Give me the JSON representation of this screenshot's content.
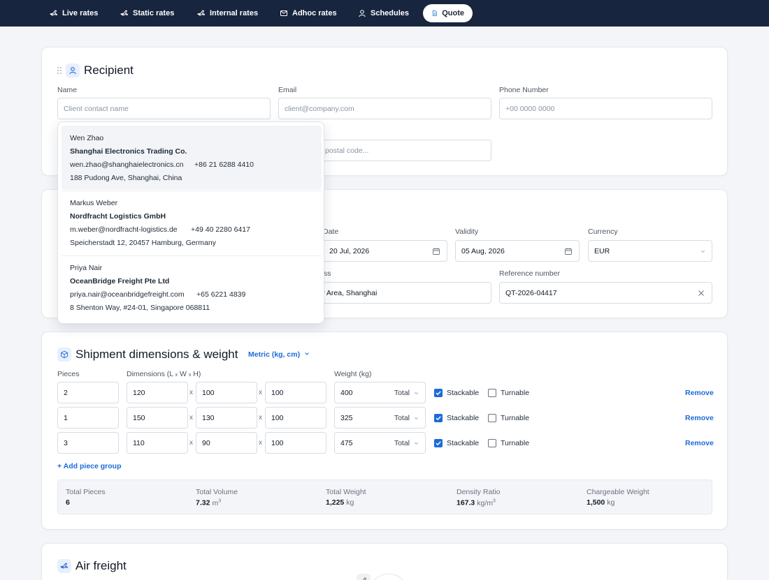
{
  "nav": {
    "items": [
      {
        "label": "Live rates",
        "icon": "plane-icon",
        "active": false
      },
      {
        "label": "Static rates",
        "icon": "plane-icon",
        "active": false
      },
      {
        "label": "Internal rates",
        "icon": "plane-icon",
        "active": false
      },
      {
        "label": "Adhoc rates",
        "icon": "mail-icon",
        "active": false
      },
      {
        "label": "Schedules",
        "icon": "user-icon",
        "active": false
      },
      {
        "label": "Quote",
        "icon": "document-icon",
        "active": true
      }
    ]
  },
  "recipient": {
    "title": "Recipient",
    "name": {
      "label": "Name",
      "placeholder": "Client contact name"
    },
    "email": {
      "label": "Email",
      "placeholder": "client@company.com"
    },
    "phone": {
      "label": "Phone Number",
      "placeholder": "+00 0000 0000"
    },
    "address_placeholder_fragment": "postal code...",
    "suggestions": [
      {
        "name": "Wen Zhao",
        "company": "Shanghai Electronics Trading Co.",
        "email": "wen.zhao@shanghaielectronics.cn",
        "phone": "+86 21 6288 4410",
        "address": "188 Pudong Ave, Shanghai, China",
        "highlighted": true
      },
      {
        "name": "Markus Weber",
        "company": "Nordfracht Logistics GmbH",
        "email": "m.weber@nordfracht-logistics.de",
        "phone": "+49 40 2280 6417",
        "address": "Speicherstadt 12, 20457 Hamburg, Germany",
        "highlighted": false
      },
      {
        "name": "Priya Nair",
        "company": "OceanBridge Freight Pte Ltd",
        "email": "priya.nair@oceanbridgefreight.com",
        "phone": "+65 6221 4839",
        "address": "8 Shenton Way, #24-01, Singapore 068811",
        "highlighted": false
      }
    ]
  },
  "quote": {
    "date": {
      "label": "Date",
      "value": "20 Jul, 2026"
    },
    "validity": {
      "label": "Validity",
      "value": "05 Aug, 2026"
    },
    "currency": {
      "label": "Currency",
      "value": "EUR"
    },
    "address": {
      "label_fragment": "ess",
      "value_fragment": "w Area, Shanghai"
    },
    "reference": {
      "label": "Reference number",
      "value": "QT-2026-04417"
    }
  },
  "shipment": {
    "title": "Shipment dimensions & weight",
    "unit_toggle": "Metric (kg, cm)",
    "headers": {
      "pieces": "Pieces",
      "dimensions_prefix": "Dimensions (L ",
      "dim_x": "x",
      "dim_w": " W ",
      "dimensions_suffix": " H)",
      "weight": "Weight (kg)"
    },
    "separator": "x",
    "rows": [
      {
        "pieces": "2",
        "length": "120",
        "width": "100",
        "height": "100",
        "weight": "400",
        "weight_mode": "Total",
        "stackable": true,
        "turnable": false
      },
      {
        "pieces": "1",
        "length": "150",
        "width": "130",
        "height": "100",
        "weight": "325",
        "weight_mode": "Total",
        "stackable": true,
        "turnable": false
      },
      {
        "pieces": "3",
        "length": "110",
        "width": "90",
        "height": "100",
        "weight": "475",
        "weight_mode": "Total",
        "stackable": true,
        "turnable": false
      }
    ],
    "stackable_label": "Stackable",
    "turnable_label": "Turnable",
    "remove_label": "Remove",
    "add_group_label": "+ Add piece group",
    "summary": {
      "total_pieces": {
        "label": "Total Pieces",
        "value": "6",
        "unit": ""
      },
      "total_volume": {
        "label": "Total Volume",
        "value": "7.32",
        "unit": "m",
        "unit_sup": "3"
      },
      "total_weight": {
        "label": "Total Weight",
        "value": "1,225",
        "unit": "kg"
      },
      "density_ratio": {
        "label": "Density Ratio",
        "value": "167.3",
        "unit": "kg/m",
        "unit_sup": "3"
      },
      "chargeable_weight": {
        "label": "Chargeable Weight",
        "value": "1,500",
        "unit": "kg"
      }
    }
  },
  "air_freight": {
    "title": "Air freight"
  },
  "colors": {
    "nav_bg": "#18253f",
    "accent": "#1d6ad8",
    "page_bg": "#f3f5f8",
    "card_bg": "#ffffff"
  }
}
